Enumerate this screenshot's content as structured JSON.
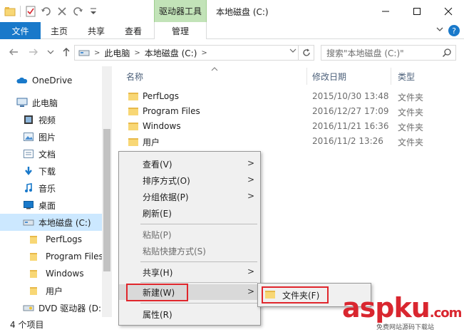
{
  "window": {
    "title": "本地磁盘 (C:)",
    "contextual_tab_group": "驱动器工具"
  },
  "ribbon": {
    "tabs": [
      {
        "label": "文件"
      },
      {
        "label": "主页"
      },
      {
        "label": "共享"
      },
      {
        "label": "查看"
      },
      {
        "label": "管理"
      }
    ],
    "help": "?"
  },
  "address": {
    "segments": [
      "此电脑",
      "本地磁盘 (C:)"
    ],
    "search_placeholder": "搜索\"本地磁盘 (C:)\""
  },
  "nav": {
    "items": [
      {
        "label": "OneDrive",
        "icon": "cloud-icon"
      },
      {
        "label": "此电脑",
        "icon": "computer-icon"
      },
      {
        "label": "视频",
        "icon": "video-icon"
      },
      {
        "label": "图片",
        "icon": "picture-icon"
      },
      {
        "label": "文档",
        "icon": "document-icon"
      },
      {
        "label": "下载",
        "icon": "download-icon"
      },
      {
        "label": "音乐",
        "icon": "music-icon"
      },
      {
        "label": "桌面",
        "icon": "desktop-icon"
      },
      {
        "label": "本地磁盘 (C:)",
        "icon": "drive-icon"
      },
      {
        "label": "PerfLogs",
        "icon": "folder-icon"
      },
      {
        "label": "Program Files",
        "icon": "folder-icon"
      },
      {
        "label": "Windows",
        "icon": "folder-icon"
      },
      {
        "label": "用户",
        "icon": "folder-icon"
      },
      {
        "label": "DVD 驱动器 (D:",
        "icon": "dvd-icon"
      }
    ]
  },
  "columns": {
    "name": "名称",
    "modified": "修改日期",
    "type": "类型"
  },
  "files": [
    {
      "name": "PerfLogs",
      "modified": "2015/10/30 13:48",
      "type": "文件夹"
    },
    {
      "name": "Program Files",
      "modified": "2016/12/27 17:09",
      "type": "文件夹"
    },
    {
      "name": "Windows",
      "modified": "2016/11/21 16:36",
      "type": "文件夹"
    },
    {
      "name": "用户",
      "modified": "2016/11/2 13:26",
      "type": "文件夹"
    }
  ],
  "context_menu": {
    "view": "查看(V)",
    "sort": "排序方式(O)",
    "group": "分组依据(P)",
    "refresh": "刷新(E)",
    "paste": "粘贴(P)",
    "paste_shortcut": "粘贴快捷方式(S)",
    "share": "共享(H)",
    "new": "新建(W)",
    "properties": "属性(R)"
  },
  "submenu": {
    "folder": "文件夹(F)"
  },
  "status": {
    "count": "4 个项目"
  },
  "watermark": {
    "brand": "aspku",
    "suffix": ".com",
    "sub": "免费网站源码下载站"
  }
}
